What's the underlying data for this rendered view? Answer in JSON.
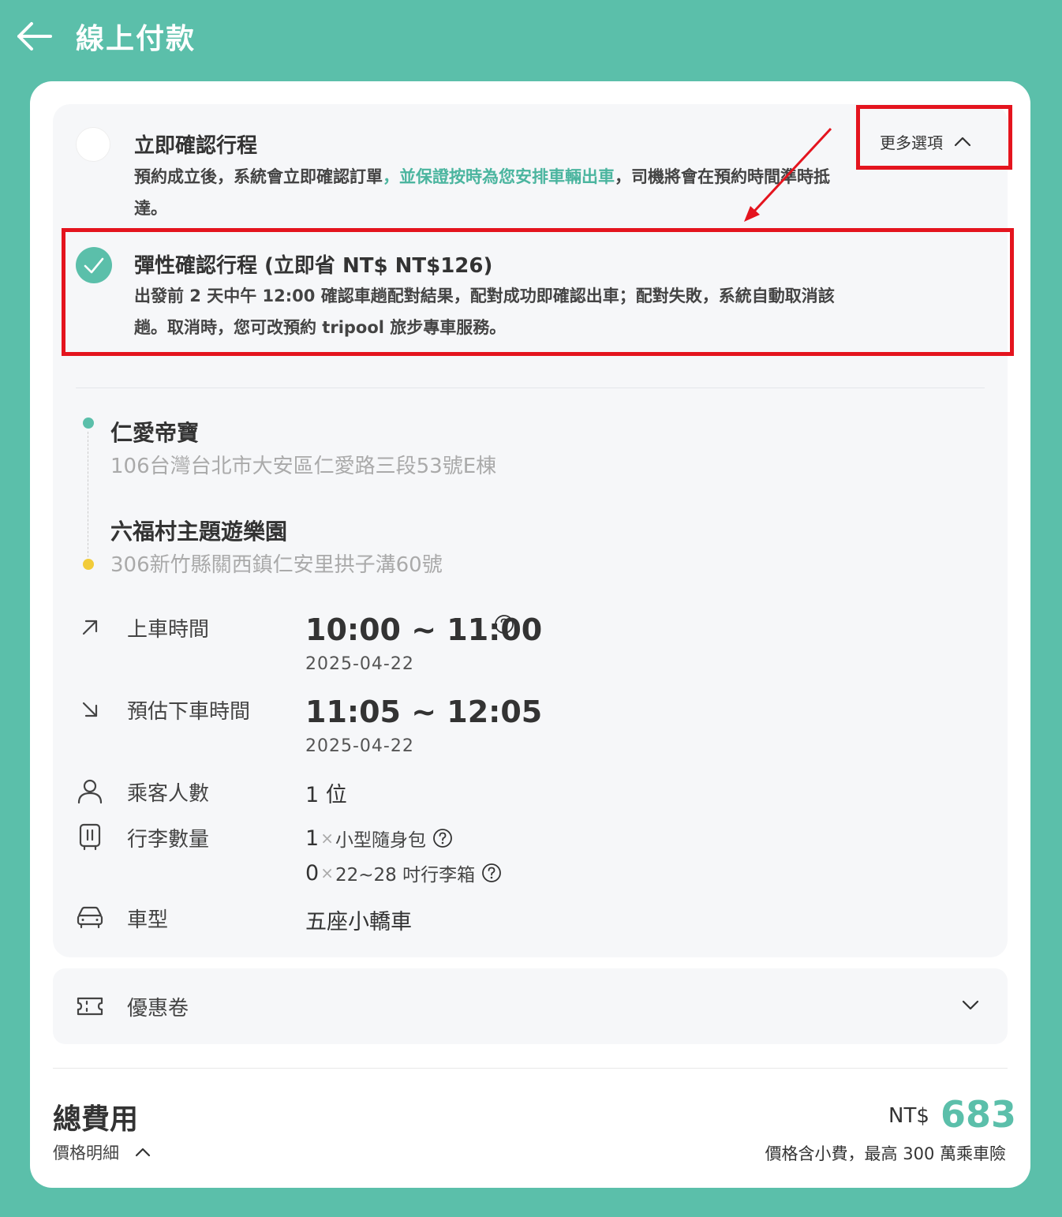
{
  "header": {
    "title": "線上付款"
  },
  "options": {
    "more_label": "更多選項",
    "instant": {
      "title": "立即確認行程",
      "desc_part1": "預約成立後，系統會立即確認訂單",
      "desc_highlight": "，並保證按時為您安排車輛出車",
      "desc_part2": "，司機將會在預約時間準時抵達。"
    },
    "flexible": {
      "title": "彈性確認行程 (立即省 NT$ NT$126)",
      "desc": "出發前 2 天中午 12:00 確認車趟配對結果，配對成功即確認出車；配對失敗，系統自動取消該趟。取消時，您可改預約 tripool 旅步專車服務。"
    }
  },
  "route": {
    "origin": {
      "name": "仁愛帝寶",
      "address": "106台灣台北市大安區仁愛路三段53號E棟"
    },
    "destination": {
      "name": "六福村主題遊樂園",
      "address": "306新竹縣關西鎮仁安里拱子溝60號"
    },
    "origin_dot_color": "#5bbfaa",
    "destination_dot_color": "#f2cc3a"
  },
  "trip": {
    "pickup_label": "上車時間",
    "pickup_range": "10:00 ~ 11:00",
    "pickup_date": "2025-04-22",
    "dropoff_label": "預估下車時間",
    "dropoff_range": "11:05 ~ 12:05",
    "dropoff_date": "2025-04-22",
    "passengers_label": "乘客人數",
    "passengers_value": "1 位",
    "luggage_label": "行李數量",
    "luggage": [
      {
        "count": "1",
        "x": "×",
        "type": "小型隨身包"
      },
      {
        "count": "0",
        "x": "×",
        "type": "22~28 吋行李箱"
      }
    ],
    "vehicle_label": "車型",
    "vehicle_value": "五座小轎車"
  },
  "coupon": {
    "label": "優惠卷"
  },
  "total": {
    "title": "總費用",
    "detail_label": "價格明細",
    "currency": "NT$",
    "amount": "683",
    "note": "價格含小費，最高 300 萬乘車險"
  },
  "colors": {
    "brand": "#5bbfaa",
    "annotation_red": "#e4141e"
  },
  "icons": [
    "back-arrow-icon",
    "chevron-up-icon",
    "check-icon",
    "arrow-up-right-icon",
    "arrow-down-right-icon",
    "help-icon",
    "user-icon",
    "luggage-icon",
    "car-icon",
    "ticket-icon",
    "chevron-down-icon"
  ]
}
